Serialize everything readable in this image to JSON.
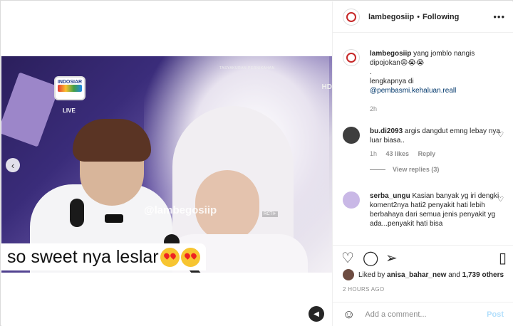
{
  "header": {
    "username": "lambegosiip",
    "separator": "•",
    "follow_status": "Following",
    "more_icon": "more-horizontal-icon"
  },
  "video": {
    "caption_text": "so sweet nya leslar",
    "watermark": "@lambegosiip",
    "channel_badge": "INDOSIAR",
    "live_label": "LIVE",
    "hd_label": "HD",
    "banner_text": "TASYAKURAN PERNIKAHAN",
    "carousel_icon": "chevron-left-icon",
    "sound_icon": "speaker-icon"
  },
  "post_caption": {
    "username": "lambegosiip",
    "text": "yang jomblo nangis dipojokan😩😭😭",
    "dot": ".",
    "more_text": "lengkapnya di",
    "link": "@pembasmi.kehaluan.reall",
    "time": "2h"
  },
  "comments": [
    {
      "username": "bu.di2093",
      "text": "argis dangdut emng lebay nya luar biasa..",
      "time": "1h",
      "likes": "43 likes",
      "reply": "Reply",
      "view_replies": "View replies (3)"
    },
    {
      "username": "serba_ungu",
      "text": "Kasian banyak yg iri dengki koment2nya hati2 penyakit hati lebih berbahaya dari semua jenis penyakit yg ada...penyakit hati bisa"
    }
  ],
  "actions": {
    "like_icon": "heart-icon",
    "comment_icon": "comment-icon",
    "share_icon": "paper-plane-icon",
    "save_icon": "bookmark-icon"
  },
  "likes": {
    "prefix": "Liked by",
    "user": "anisa_bahar_new",
    "middle": "and",
    "others": "1,739 others"
  },
  "timestamp": "2 HOURS AGO",
  "add_comment": {
    "placeholder": "Add a comment...",
    "post_label": "Post",
    "emoji_icon": "smile-icon"
  },
  "colors": {
    "link": "#00376b",
    "post_disabled": "#b2dffc",
    "muted": "#8e8e8e"
  }
}
